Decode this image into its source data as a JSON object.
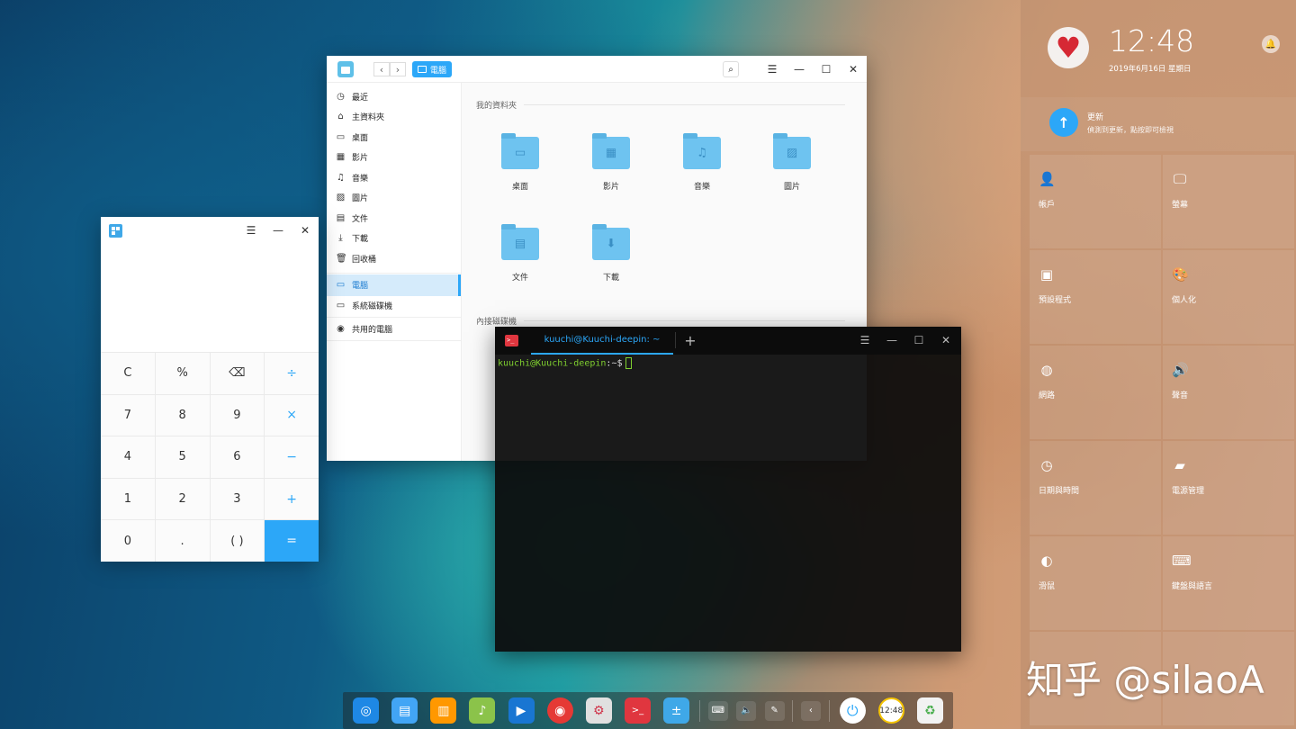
{
  "file_manager": {
    "breadcrumb": "電腦",
    "sidebar": [
      {
        "label": "最近",
        "icon": "clock-icon",
        "glyph": "◷"
      },
      {
        "label": "主資料夾",
        "icon": "home-icon",
        "glyph": "⌂"
      },
      {
        "label": "桌面",
        "icon": "desktop-icon",
        "glyph": "▭"
      },
      {
        "label": "影片",
        "icon": "video-icon",
        "glyph": "▦"
      },
      {
        "label": "音樂",
        "icon": "music-icon",
        "glyph": "♫"
      },
      {
        "label": "圖片",
        "icon": "picture-icon",
        "glyph": "▨"
      },
      {
        "label": "文件",
        "icon": "document-icon",
        "glyph": "▤"
      },
      {
        "label": "下載",
        "icon": "download-icon",
        "glyph": "⤓"
      },
      {
        "label": "回收桶",
        "icon": "trash-icon",
        "glyph": "🗑"
      }
    ],
    "sidebar_active": {
      "label": "電腦",
      "icon": "computer-icon",
      "glyph": "▭"
    },
    "sidebar_devices": [
      {
        "label": "系統磁碟機",
        "icon": "disk-icon",
        "glyph": "▭"
      },
      {
        "label": "共用的電腦",
        "icon": "network-icon",
        "glyph": "◉"
      }
    ],
    "section_folders": "我的資料夾",
    "folders": [
      {
        "label": "桌面",
        "glyph": "▭"
      },
      {
        "label": "影片",
        "glyph": "▦"
      },
      {
        "label": "音樂",
        "glyph": "♫"
      },
      {
        "label": "圖片",
        "glyph": "▨"
      },
      {
        "label": "文件",
        "glyph": "▤"
      },
      {
        "label": "下載",
        "glyph": "⬇"
      }
    ],
    "section_disks": "內接磁碟機"
  },
  "calculator": {
    "keys": [
      "C",
      "%",
      "⌫",
      "÷",
      "7",
      "8",
      "9",
      "×",
      "4",
      "5",
      "6",
      "−",
      "1",
      "2",
      "3",
      "+",
      "0",
      ".",
      "( )",
      "="
    ]
  },
  "terminal": {
    "tab_title": "kuuchi@Kuuchi-deepin: ~",
    "prompt_user": "kuuchi@Kuuchi-deepin",
    "prompt_path": ":~$"
  },
  "control_center": {
    "time": "12:48",
    "date": "2019年6月16日 星期日",
    "update_title": "更新",
    "update_desc": "偵測到更新，點按即可檢視",
    "tiles": [
      {
        "label": "帳戶",
        "icon": "user-icon",
        "glyph": "👤"
      },
      {
        "label": "螢幕",
        "icon": "display-icon",
        "glyph": "🖵"
      },
      {
        "label": "預設程式",
        "icon": "default-apps-icon",
        "glyph": "▣"
      },
      {
        "label": "個人化",
        "icon": "palette-icon",
        "glyph": "🎨"
      },
      {
        "label": "網路",
        "icon": "network-icon",
        "glyph": "◍"
      },
      {
        "label": "聲音",
        "icon": "sound-icon",
        "glyph": "🔊"
      },
      {
        "label": "日期與時間",
        "icon": "clock-icon",
        "glyph": "◷"
      },
      {
        "label": "電源管理",
        "icon": "power-icon",
        "glyph": "▰"
      },
      {
        "label": "滑鼠",
        "icon": "mouse-icon",
        "glyph": "◐"
      },
      {
        "label": "鍵盤與語言",
        "icon": "keyboard-icon",
        "glyph": "⌨"
      }
    ]
  },
  "dock": {
    "apps": [
      {
        "name": "launcher-icon",
        "color": "#1e88e5",
        "glyph": "◎"
      },
      {
        "name": "file-manager-icon",
        "color": "#42a5f5",
        "glyph": "▤"
      },
      {
        "name": "app-store-icon",
        "color": "#ff9800",
        "glyph": "▥"
      },
      {
        "name": "music-player-icon",
        "color": "#8bc34a",
        "glyph": "♪"
      },
      {
        "name": "movie-player-icon",
        "color": "#1976d2",
        "glyph": "▶"
      },
      {
        "name": "chrome-icon",
        "color": "#e53935",
        "glyph": "◉"
      },
      {
        "name": "settings-icon",
        "color": "#e0e0e0",
        "glyph": "⚙"
      },
      {
        "name": "terminal-icon",
        "color": "#e0363f",
        "glyph": ">_"
      },
      {
        "name": "calculator-icon",
        "color": "#3fa8e8",
        "glyph": "±"
      }
    ],
    "tray": [
      {
        "name": "keyboard-tray-icon",
        "glyph": "⌨"
      },
      {
        "name": "volume-tray-icon",
        "glyph": "🔈"
      },
      {
        "name": "pen-tray-icon",
        "glyph": "✎"
      }
    ],
    "clock_text": "12:48"
  },
  "watermark": "知乎 @silaoA"
}
